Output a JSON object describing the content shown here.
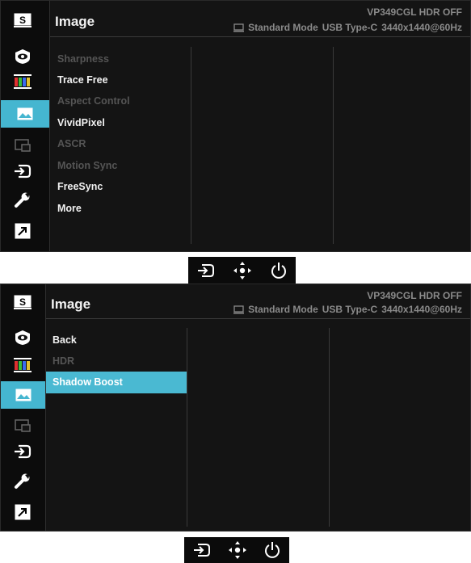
{
  "panel1": {
    "title": "Image",
    "model": "VP349CGL HDR OFF",
    "status": {
      "mode": "Standard Mode",
      "input": "USB Type-C",
      "resolution": "3440x1440@60Hz"
    },
    "menu": [
      {
        "label": "Sharpness",
        "enabled": false
      },
      {
        "label": "Trace Free",
        "enabled": true
      },
      {
        "label": "Aspect Control",
        "enabled": false
      },
      {
        "label": "VividPixel",
        "enabled": true
      },
      {
        "label": "ASCR",
        "enabled": false
      },
      {
        "label": "Motion Sync",
        "enabled": false
      },
      {
        "label": "FreeSync",
        "enabled": true
      },
      {
        "label": "More",
        "enabled": true
      }
    ]
  },
  "panel2": {
    "title": "Image",
    "model": "VP349CGL HDR OFF",
    "status": {
      "mode": "Standard Mode",
      "input": "USB Type-C",
      "resolution": "3440x1440@60Hz"
    },
    "menu": [
      {
        "label": "Back",
        "enabled": true
      },
      {
        "label": "HDR",
        "enabled": false
      },
      {
        "label": "Shadow Boost",
        "enabled": true,
        "selected": true
      }
    ]
  },
  "sidebar": {
    "items": [
      "splendid-icon",
      "eye-icon",
      "color-icon",
      "image-icon",
      "pip-icon",
      "input-select-icon",
      "system-setup-icon",
      "shortcut-icon"
    ],
    "splendid_glyph": "S"
  },
  "keys": [
    "input-icon",
    "five-way-navigation-icon",
    "power-icon"
  ],
  "colors": {
    "accent": "#45b6d0",
    "background": "#141414",
    "text": "#f2f2f2",
    "disabled": "#555555"
  }
}
